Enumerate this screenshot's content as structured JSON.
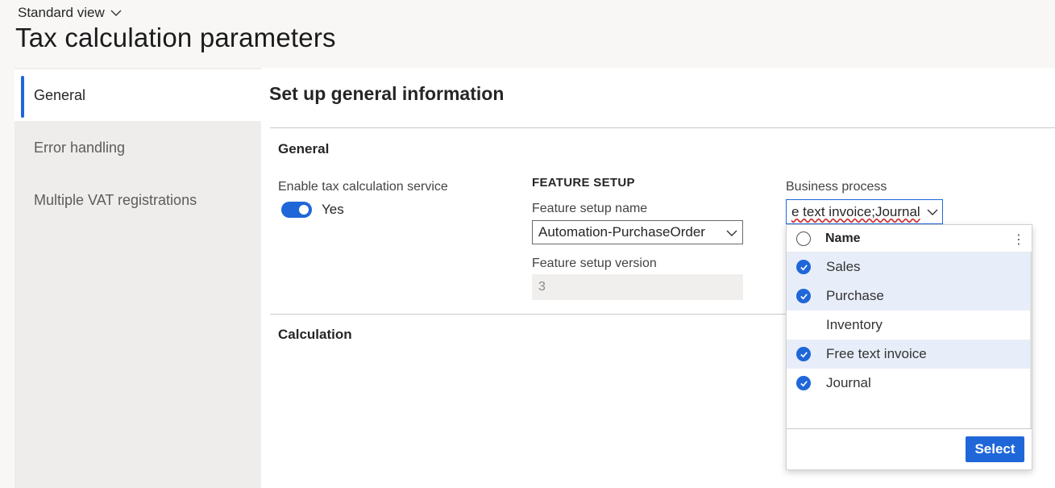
{
  "header": {
    "view_label": "Standard view",
    "title": "Tax calculation parameters"
  },
  "tabs": [
    {
      "label": "General",
      "selected": true
    },
    {
      "label": "Error handling",
      "selected": false
    },
    {
      "label": "Multiple VAT registrations",
      "selected": false
    }
  ],
  "main": {
    "section_title": "Set up general information",
    "general_group": "General",
    "calculation_group": "Calculation",
    "enable_service_label": "Enable tax calculation service",
    "enable_service_value": "Yes",
    "feature_setup": {
      "heading": "FEATURE SETUP",
      "name_label": "Feature setup name",
      "name_value": "Automation-PurchaseOrder",
      "version_label": "Feature setup version",
      "version_value": "3"
    },
    "business_process": {
      "label": "Business process",
      "value": "e text invoice;Journal"
    }
  },
  "dropdown": {
    "column_header": "Name",
    "items": [
      {
        "label": "Sales",
        "checked": true
      },
      {
        "label": "Purchase",
        "checked": true
      },
      {
        "label": "Inventory",
        "checked": false
      },
      {
        "label": "Free text invoice",
        "checked": true
      },
      {
        "label": "Journal",
        "checked": true
      }
    ],
    "select_label": "Select"
  },
  "colors": {
    "accent": "#1f67d9",
    "selected_row": "#e8eef9"
  }
}
